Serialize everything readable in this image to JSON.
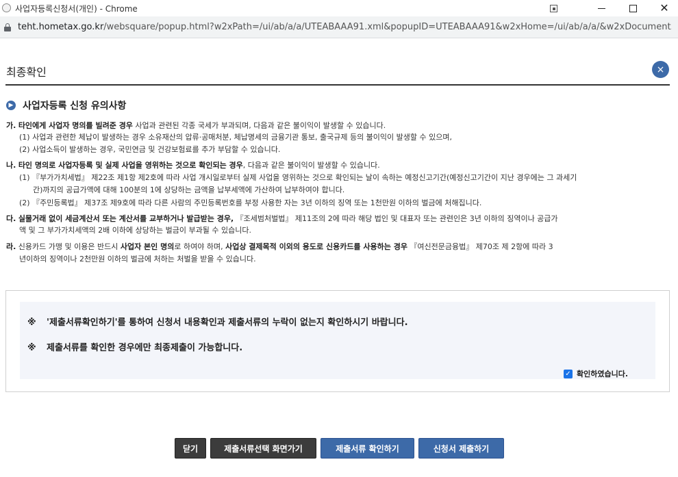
{
  "window": {
    "title": "사업자등록신청서(개인) - Chrome"
  },
  "address_bar": {
    "domain": "teht.hometax.go.kr",
    "path": "/websquare/popup.html?w2xPath=/ui/ab/a/a/UTEABAAA91.xml&popupID=UTEABAAA91&w2xHome=/ui/ab/a/a/&w2xDocument..."
  },
  "popup": {
    "title": "최종확인",
    "close_symbol": "×"
  },
  "section": {
    "title": "사업자등록 신청 유의사항"
  },
  "notes": {
    "ga": {
      "prefix": "가.",
      "bold": "타인에게 사업자 명의를 빌려준 경우",
      "text": " 사업과 관련된 각종 국세가 부과되며, 다음과 같은 불이익이 발생할 수 있습니다.",
      "sub1": "(1) 사업과 관련한 체납이 발생하는 경우 소유재산의 압류·공매처분, 체납명세의 금융기관 통보, 출국규제 등의 불이익이 발생할 수 있으며,",
      "sub2": "(2) 사업소득이 발생하는 경우, 국민연금 및 건강보험료를 추가 부담할 수 있습니다."
    },
    "na": {
      "prefix": "나.",
      "bold": "타인 명의로 사업자등록 및 실제 사업을 영위하는 것으로 확인되는 경우",
      "text": ", 다음과 같은 불이익이 발생할 수 있습니다.",
      "sub1a": "(1) 『부가가치세법』 제22조 제1항 제2호에 따라 사업 개시일로부터 실제 사업을 영위하는 것으로 확인되는 날이 속하는 예정신고기간(예정신고기간이 지난 경우에는 그 과세기",
      "sub1b": "간)까지의 공급가액에 대해 100분의 1에 상당하는 금액을 납부세액에 가산하여 납부하여야 합니다.",
      "sub2": "(2) 『주민등록법』 제37조 제9호에 따라 다른 사람의 주민등록번호를 부정 사용한 자는 3년 이하의 징역 또는 1천만원 이하의 벌금에 처해집니다."
    },
    "da": {
      "prefix": "다.",
      "bold": "실물거래 없이 세금계산서 또는 계산서를 교부하거나 발급받는 경우,",
      "text": " 『조세범처벌법』 제11조의 2에 따라 해당 법인 및 대표자 또는 관련인은 3년 이하의 징역이나 공급가",
      "cont": "액 및 그 부가가치세액의 2배 이하에 상당하는 벌금이 부과될 수 있습니다."
    },
    "ra": {
      "prefix": "라.",
      "text1": " 신용카드 가맹 및 이용은 반드시 ",
      "bold1": "사업자 본인 명의",
      "text2": "로 하여야 하며, ",
      "bold2": "사업상 결제목적 이외의 용도로 신용카드를 사용하는 경우",
      "text3": " 『여신전문금융법』 제70조 제 2항에 따라 3",
      "cont": "년이하의 징역이나 2천만원 이하의 벌금에 처하는 처벌을 받을 수 있습니다."
    }
  },
  "confirm": {
    "mark": "※",
    "line1": "'제출서류확인하기'를 통하여 신청서 내용확인과 제출서류의 누락이 없는지 확인하시기 바랍니다.",
    "line2": "제출서류를 확인한 경우에만 최종제출이 가능합니다.",
    "checkbox_label": "확인하였습니다.",
    "checkbox_checked": true
  },
  "buttons": {
    "close": "닫기",
    "select_docs": "제출서류선택 화면가기",
    "check_docs": "제출서류 확인하기",
    "submit": "신청서 제출하기"
  },
  "colors": {
    "accent": "#3d6aa8",
    "dark_button": "#3c3c3c",
    "confirm_bg": "#f3f5fa",
    "checkbox": "#1a73e8"
  }
}
